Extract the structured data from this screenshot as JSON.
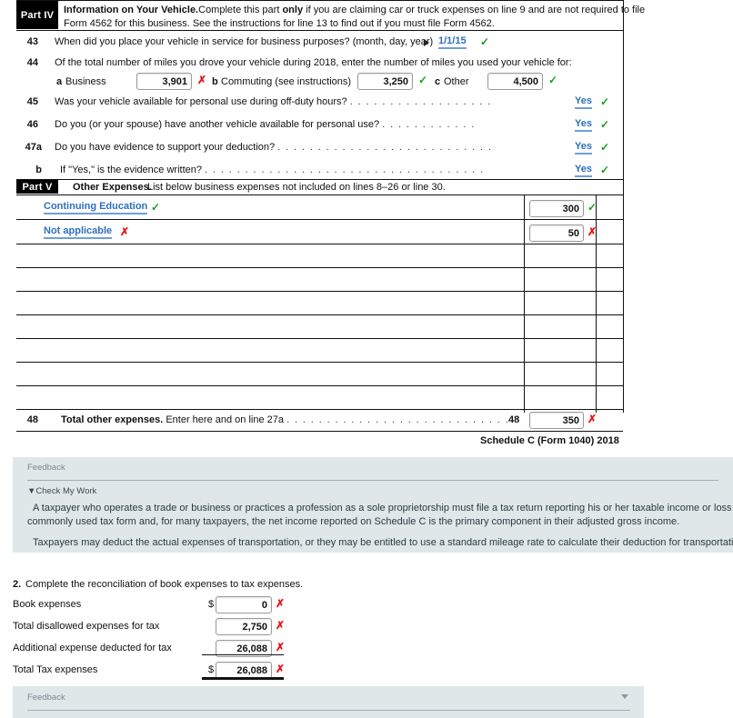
{
  "form": {
    "part4": {
      "tag": "Part IV",
      "title": "Information on Your Vehicle.",
      "desc_1a": "Complete this part ",
      "desc_1b": "only",
      "desc_1c": " if you are claiming car or truck expenses on line 9 and are not required to file",
      "desc_2": "Form 4562 for this business. See the instructions for line 13 to find out if you must file Form 4562."
    },
    "line43": {
      "no": "43",
      "text": "When did you place your vehicle in service for business purposes? (month, day, year)",
      "value": "1/1/15",
      "status": "check"
    },
    "line44": {
      "no": "44",
      "text": "Of the total number of miles you drove your vehicle during 2018, enter the number of miles you used your vehicle for:",
      "a_letter": "a",
      "a_label": "Business",
      "a_value": "3,901",
      "a_status": "x",
      "b_letter": "b",
      "b_label": "Commuting (see instructions)",
      "b_value": "3,250",
      "b_status": "check",
      "c_letter": "c",
      "c_label": "Other",
      "c_value": "4,500",
      "c_status": "check"
    },
    "questions": [
      {
        "no": "45",
        "text": "Was your vehicle available for personal use during off-duty hours?",
        "dots": ". . . . . . . . . . . . . . . . . .",
        "answer": "Yes",
        "status": "check"
      },
      {
        "no": "46",
        "text": "Do you (or your spouse) have another vehicle available for personal use?",
        "dots": ". . . . . . . . . . . .",
        "answer": "Yes",
        "status": "check"
      },
      {
        "no": "47a",
        "text": "Do you have evidence to support your deduction?",
        "dots": ". . . . . . . . . . . . . . . . . . . . . . . . . . .",
        "answer": "Yes",
        "status": "check"
      },
      {
        "no": "b",
        "text": "If \"Yes,\" is the evidence written?",
        "dots": ". . . . . . . . . . . . . . . . . . . . . . . . . . . . . . . . . . .",
        "answer": "Yes",
        "status": "check"
      }
    ],
    "part5": {
      "tag": "Part V",
      "title": "Other Expenses.",
      "desc": "List below business expenses not included on lines 8–26 or line 30."
    },
    "expense_rows": [
      {
        "description": "Continuing Education",
        "desc_status": "check",
        "amount": "300",
        "amount_status": "check"
      },
      {
        "description": "Not applicable",
        "desc_status": "x",
        "amount": "50",
        "amount_status": "x"
      },
      {
        "description": "",
        "desc_status": "",
        "amount": "",
        "amount_status": ""
      },
      {
        "description": "",
        "desc_status": "",
        "amount": "",
        "amount_status": ""
      },
      {
        "description": "",
        "desc_status": "",
        "amount": "",
        "amount_status": ""
      },
      {
        "description": "",
        "desc_status": "",
        "amount": "",
        "amount_status": ""
      },
      {
        "description": "",
        "desc_status": "",
        "amount": "",
        "amount_status": ""
      },
      {
        "description": "",
        "desc_status": "",
        "amount": "",
        "amount_status": ""
      },
      {
        "description": "",
        "desc_status": "",
        "amount": "",
        "amount_status": ""
      }
    ],
    "line48": {
      "no": "48",
      "bold_text": "Total other expenses.",
      "text": " Enter here and on line 27a",
      "dots": ". . . . . . . . . . . . . . . . . . . . . . . . . . . .",
      "col_no": "48",
      "value": "350",
      "status": "x"
    },
    "footer": "Schedule C (Form 1040) 2018"
  },
  "feedback_top": {
    "title": "Feedback",
    "check_my_work": "Check My Work",
    "paragraph1_line1": "A taxpayer who operates a trade or business or practices a profession as a sole proprietorship must file a tax return reporting his or her taxable income or loss from the a",
    "paragraph1_line2": "commonly used tax form and, for many taxpayers, the net income reported on Schedule C is the primary component in their adjusted gross income.",
    "paragraph2": "Taxpayers may deduct the actual expenses of transportation, or they may be entitled to use a standard mileage rate to calculate their deduction for transportation costs."
  },
  "reconciliation": {
    "prompt_no": "2.",
    "prompt": "Complete the reconciliation of book expenses to tax expenses.",
    "rows": [
      {
        "label": "Book expenses",
        "dollar": "$",
        "value": "0",
        "status": "x"
      },
      {
        "label": "Total disallowed expenses for tax",
        "dollar": "",
        "value": "2,750",
        "status": "x"
      },
      {
        "label": "Additional expense deducted for tax",
        "dollar": "",
        "value": "26,088",
        "status": "x"
      },
      {
        "label": "Total Tax expenses",
        "dollar": "$",
        "value": "26,088",
        "status": "x"
      }
    ]
  },
  "feedback_bottom": {
    "title": "Feedback",
    "caret": "caret-down-icon"
  },
  "colors": {
    "link": "#2e6fbd",
    "check": "#17a01a",
    "x": "#ee1111",
    "panel": "#dfe7e9",
    "black": "#000000"
  }
}
